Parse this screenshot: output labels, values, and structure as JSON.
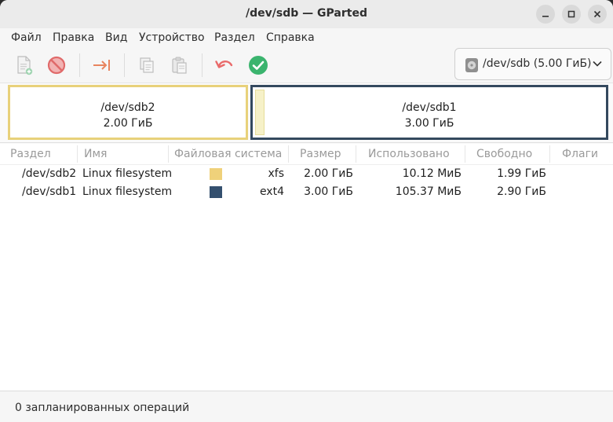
{
  "window": {
    "title": "/dev/sdb — GParted"
  },
  "menubar": {
    "items": [
      "Файл",
      "Правка",
      "Вид",
      "Устройство",
      "Раздел",
      "Справка"
    ]
  },
  "toolbar": {
    "buttons": [
      {
        "icon": "new-partition-icon",
        "enabled": false
      },
      {
        "icon": "delete-icon",
        "enabled": true
      },
      {
        "icon": "resize-move-icon",
        "enabled": true
      },
      {
        "icon": "copy-icon",
        "enabled": false
      },
      {
        "icon": "paste-icon",
        "enabled": false
      },
      {
        "icon": "undo-icon",
        "enabled": true
      },
      {
        "icon": "apply-icon",
        "enabled": true
      }
    ],
    "device": {
      "label": "/dev/sdb (5.00 ГиБ)",
      "icon": "disk-icon"
    }
  },
  "visual": {
    "partitions": [
      {
        "name": "/dev/sdb2",
        "size": "2.00 ГиБ",
        "border": "#e8d17a",
        "selected": true
      },
      {
        "name": "/dev/sdb1",
        "size": "3.00 ГиБ",
        "border": "#34495e",
        "used_fill": "#f6f1c8",
        "selected": false
      }
    ]
  },
  "table": {
    "columns": [
      "Раздел",
      "Имя",
      "Файловая система",
      "Размер",
      "Использовано",
      "Свободно",
      "Флаги"
    ],
    "rows": [
      {
        "partition": "/dev/sdb2",
        "name": "Linux filesystem",
        "fs_color": "#efd17a",
        "fs": "xfs",
        "size": "2.00 ГиБ",
        "used": "10.12 МиБ",
        "free": "1.99 ГиБ",
        "flags": ""
      },
      {
        "partition": "/dev/sdb1",
        "name": "Linux filesystem",
        "fs_color": "#34506f",
        "fs": "ext4",
        "size": "3.00 ГиБ",
        "used": "105.37 МиБ",
        "free": "2.90 ГиБ",
        "flags": ""
      }
    ]
  },
  "status": {
    "text": "0 запланированных операций"
  },
  "colors": {
    "accent_green": "#3bb46e",
    "delete_red": "#e36a6a",
    "ext4": "#34506f",
    "xfs": "#efd17a"
  }
}
